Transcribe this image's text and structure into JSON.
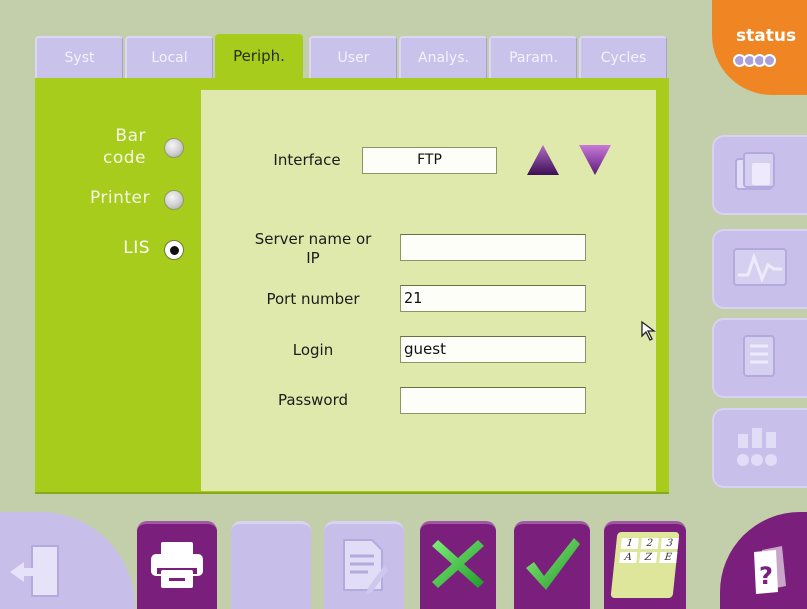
{
  "tabs": [
    {
      "label": "Syst"
    },
    {
      "label": "Local"
    },
    {
      "label": "Periph."
    },
    {
      "label": "User"
    },
    {
      "label": "Analys."
    },
    {
      "label": "Param."
    },
    {
      "label": "Cycles"
    }
  ],
  "active_tab": "Periph.",
  "status": {
    "label": "status"
  },
  "peripherals": {
    "barcode_label_1": "Bar",
    "barcode_label_2": "code",
    "printer_label": "Printer",
    "lis_label": "LIS",
    "selected": "LIS"
  },
  "form": {
    "interface_label": "Interface",
    "interface_value": "FTP",
    "server_label_1": "Server name or",
    "server_label_2": "IP",
    "server_value": "",
    "port_label": "Port number",
    "port_value": "21",
    "login_label": "Login",
    "login_value": "guest",
    "password_label": "Password",
    "password_value": ""
  },
  "keypad": {
    "keys": [
      "1",
      "2",
      "3",
      "A",
      "Z",
      "E"
    ]
  },
  "help": {
    "symbol": "?"
  },
  "colors": {
    "accent_green": "#a8cc1c",
    "panel_green": "#dee9ab",
    "purple_dark": "#7b1f7c",
    "purple_light": "#c7bfe9",
    "status_orange": "#f08523"
  }
}
